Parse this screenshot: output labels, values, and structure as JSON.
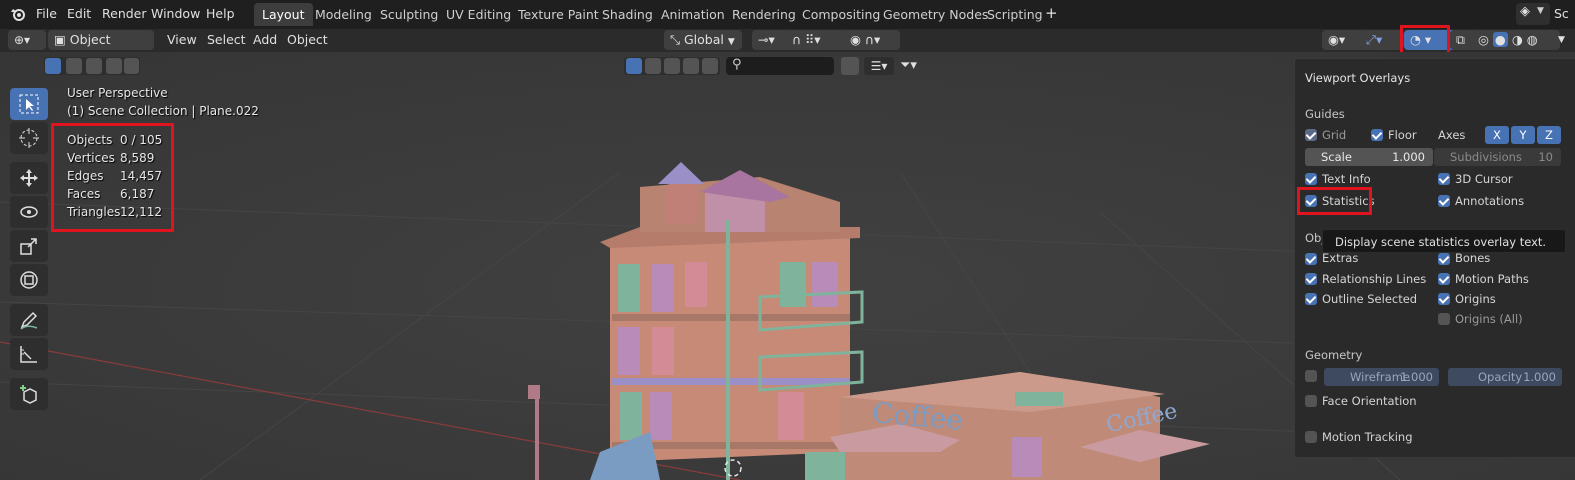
{
  "menu": {
    "items": [
      "File",
      "Edit",
      "Render",
      "Window",
      "Help"
    ],
    "workspaces": [
      "Layout",
      "Modeling",
      "Sculpting",
      "UV Editing",
      "Texture Paint",
      "Shading",
      "Animation",
      "Rendering",
      "Compositing",
      "Geometry Nodes",
      "Scripting"
    ],
    "active_workspace": "Layout",
    "add_tab": "+",
    "scene_label": "Sc"
  },
  "header": {
    "mode": "Object Mode",
    "menus": [
      "View",
      "Select",
      "Add",
      "Object"
    ],
    "transform_orientation": "Global",
    "search_placeholder": ""
  },
  "viewport": {
    "perspective": "User Perspective",
    "collection": "(1) Scene Collection | Plane.022",
    "stats": [
      {
        "label": "Objects",
        "value": "0 / 105"
      },
      {
        "label": "Vertices",
        "value": "8,589"
      },
      {
        "label": "Edges",
        "value": "14,457"
      },
      {
        "label": "Faces",
        "value": "6,187"
      },
      {
        "label": "Triangles",
        "value": "12,112"
      }
    ],
    "sign_text_1": "Coffee",
    "sign_text_2": "Coffee"
  },
  "overlays": {
    "title": "Viewport Overlays",
    "guides": {
      "heading": "Guides",
      "grid": "Grid",
      "floor": "Floor",
      "axes_label": "Axes",
      "axes": [
        "X",
        "Y",
        "Z"
      ],
      "scale_label": "Scale",
      "scale_value": "1.000",
      "subdivisions_label": "Subdivisions",
      "subdivisions_value": "10",
      "text_info": "Text Info",
      "cursor_3d": "3D Cursor",
      "statistics": "Statistics",
      "annotations": "Annotations"
    },
    "objects": {
      "heading": "Obj",
      "extras": "Extras",
      "bones": "Bones",
      "relationship_lines": "Relationship Lines",
      "motion_paths": "Motion Paths",
      "outline_selected": "Outline Selected",
      "origins": "Origins",
      "origins_all": "Origins (All)"
    },
    "geometry": {
      "heading": "Geometry",
      "wireframe_label": "Wireframe",
      "wireframe_value": "1.000",
      "opacity_label": "Opacity",
      "opacity_value": "1.000",
      "face_orientation": "Face Orientation"
    },
    "motion_tracking": "Motion Tracking",
    "tooltip": "Display scene statistics overlay text."
  },
  "colors": {
    "accent": "#4772b3",
    "highlight": "#e0141f",
    "header_bg": "#1f1f1f",
    "viewport_bg": "#393939"
  }
}
